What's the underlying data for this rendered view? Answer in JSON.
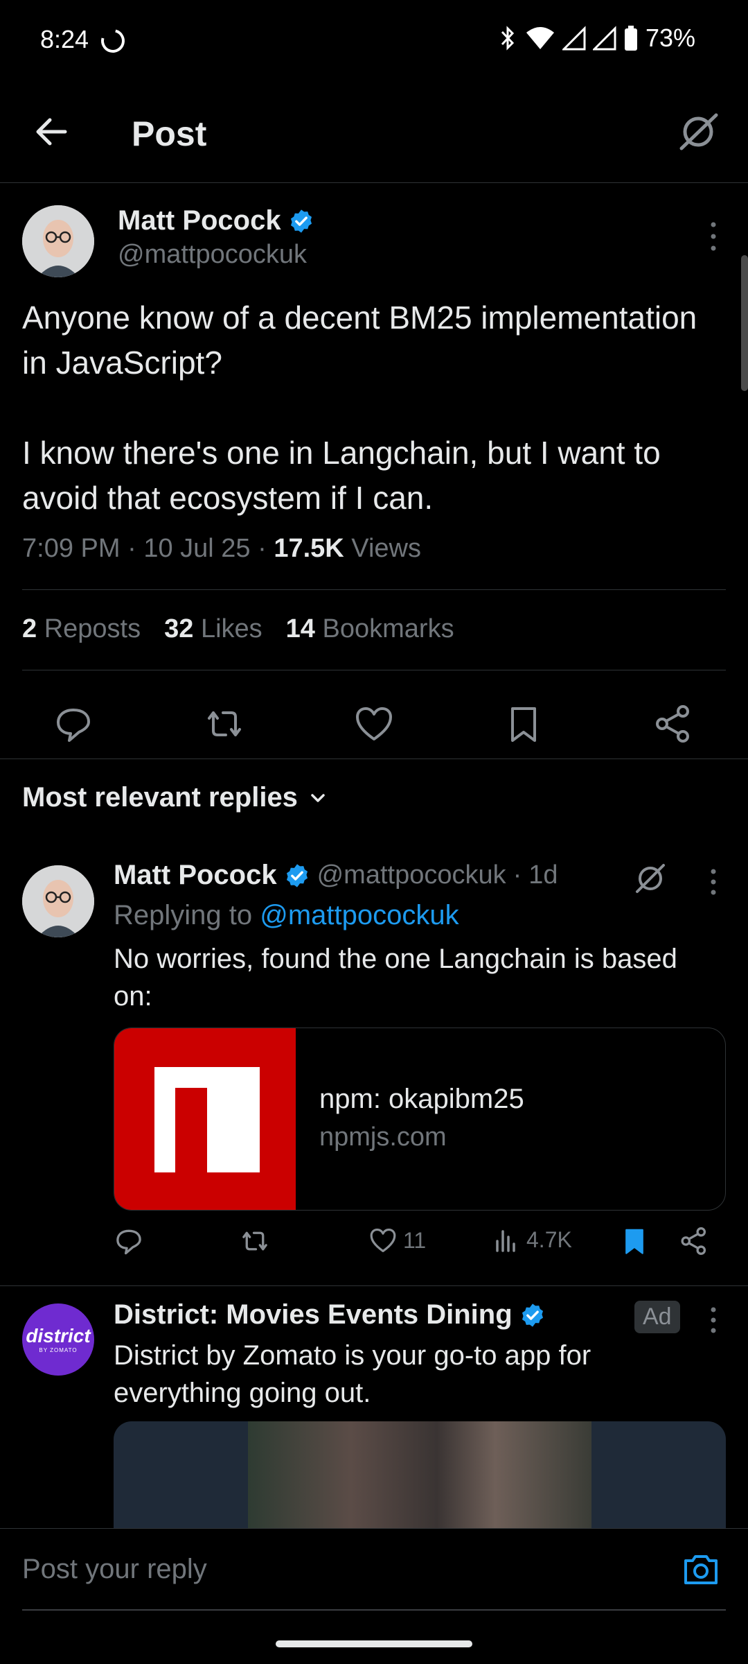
{
  "status_bar": {
    "time": "8:24",
    "battery": "73%"
  },
  "header": {
    "title": "Post"
  },
  "post": {
    "author": {
      "name": "Matt Pocock",
      "handle": "@mattpocockuk"
    },
    "text": "Anyone know of a decent BM25 implementation in JavaScript?\n\nI know there's one in Langchain, but I want to avoid that ecosystem if I can.",
    "time": "7:09 PM",
    "date": "10 Jul 25",
    "views_count": "17.5K",
    "views_label": "Views",
    "stats": {
      "reposts_count": "2",
      "reposts_label": "Reposts",
      "likes_count": "32",
      "likes_label": "Likes",
      "bookmarks_count": "14",
      "bookmarks_label": "Bookmarks"
    }
  },
  "replies_sort": {
    "label": "Most relevant replies"
  },
  "reply": {
    "author": {
      "name": "Matt Pocock",
      "handle": "@mattpocockuk",
      "age": "1d"
    },
    "replying_prefix": "Replying to",
    "replying_handle": "@mattpocockuk",
    "text": "No worries, found the one Langchain is based on:",
    "card": {
      "title": "npm: okapibm25",
      "domain": "npmjs.com"
    },
    "likes": "11",
    "views": "4.7K"
  },
  "ad": {
    "name": "District: Movies Events Dining",
    "badge": "Ad",
    "text": "District by Zomato is your go-to app for everything going out.",
    "logo_text": "district",
    "logo_sub": "BY ZOMATO"
  },
  "composer": {
    "placeholder": "Post your reply"
  },
  "colors": {
    "accent": "#1d9bf0",
    "background": "#000000",
    "muted": "#71767b",
    "npm_red": "#cb0000",
    "district_purple": "#6f2bd0"
  },
  "icons": [
    "back-arrow-icon",
    "grok-icon",
    "verified-badge-icon",
    "more-vertical-icon",
    "reply-icon",
    "repost-icon",
    "like-icon",
    "bookmark-icon",
    "share-icon",
    "views-icon",
    "chevron-down-icon",
    "camera-icon"
  ]
}
